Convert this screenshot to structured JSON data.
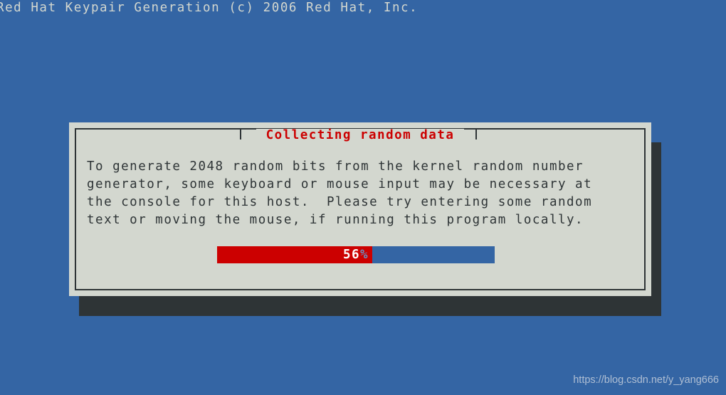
{
  "screen": {
    "background_color": "#3465a4",
    "header_line": "Red Hat Keypair Generation (c) 2006 Red Hat, Inc."
  },
  "dialog": {
    "title": "Collecting random data",
    "title_color": "#cc0000",
    "panel_color": "#d3d7cf",
    "border_color": "#2e3436",
    "shadow_color": "#2e3436",
    "body_lines": [
      "To generate 2048 random bits from the kernel random number",
      "generator, some keyboard or mouse input may be necessary at",
      "the console for this host.  Please try entering some random",
      "text or moving the mouse, if running this program locally."
    ],
    "body_text": "To generate 2048 random bits from the kernel random number\ngenerator, some keyboard or mouse input may be necessary at\nthe console for this host.  Please try entering some random\ntext or moving the mouse, if running this program locally.",
    "progress": {
      "percent": 56,
      "value_label": "56",
      "unit_label": "%",
      "fill_color": "#cc0000",
      "track_color": "#3465a4",
      "value_color": "#ffffff",
      "unit_color": "#6b8fc0"
    }
  },
  "watermark": {
    "text": "https://blog.csdn.net/y_yang666",
    "color": "#b9c6d8"
  }
}
